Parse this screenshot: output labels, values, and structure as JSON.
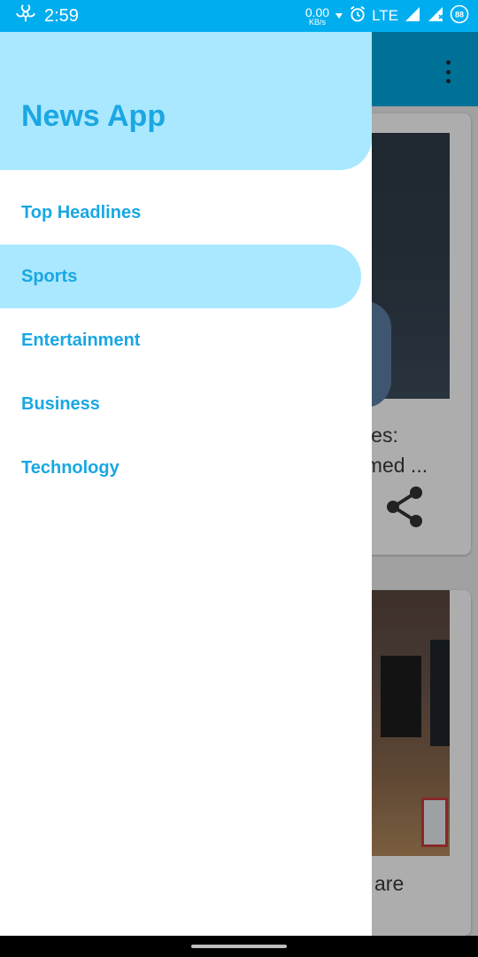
{
  "status_bar": {
    "time": "2:59",
    "net_speed_value": "0.00",
    "net_speed_unit": "KB/s",
    "network_type": "LTE",
    "icons": [
      "biohazard-icon",
      "download-arrow-icon",
      "alarm-icon",
      "signal-icon",
      "signal-icon",
      "battery-icon"
    ],
    "battery_level": "88"
  },
  "background": {
    "card1_title": "ates:\nnmed ...",
    "card2_title": "is are"
  },
  "drawer": {
    "title": "News App",
    "items": [
      {
        "label": "Top Headlines",
        "active": false
      },
      {
        "label": "Sports",
        "active": true
      },
      {
        "label": "Entertainment",
        "active": false
      },
      {
        "label": "Business",
        "active": false
      },
      {
        "label": "Technology",
        "active": false
      }
    ]
  },
  "colors": {
    "status_bar": "#00aeef",
    "accent_text": "#1aa7e3",
    "header_bg": "#aae8ff",
    "active_item_bg": "#aae8ff"
  }
}
